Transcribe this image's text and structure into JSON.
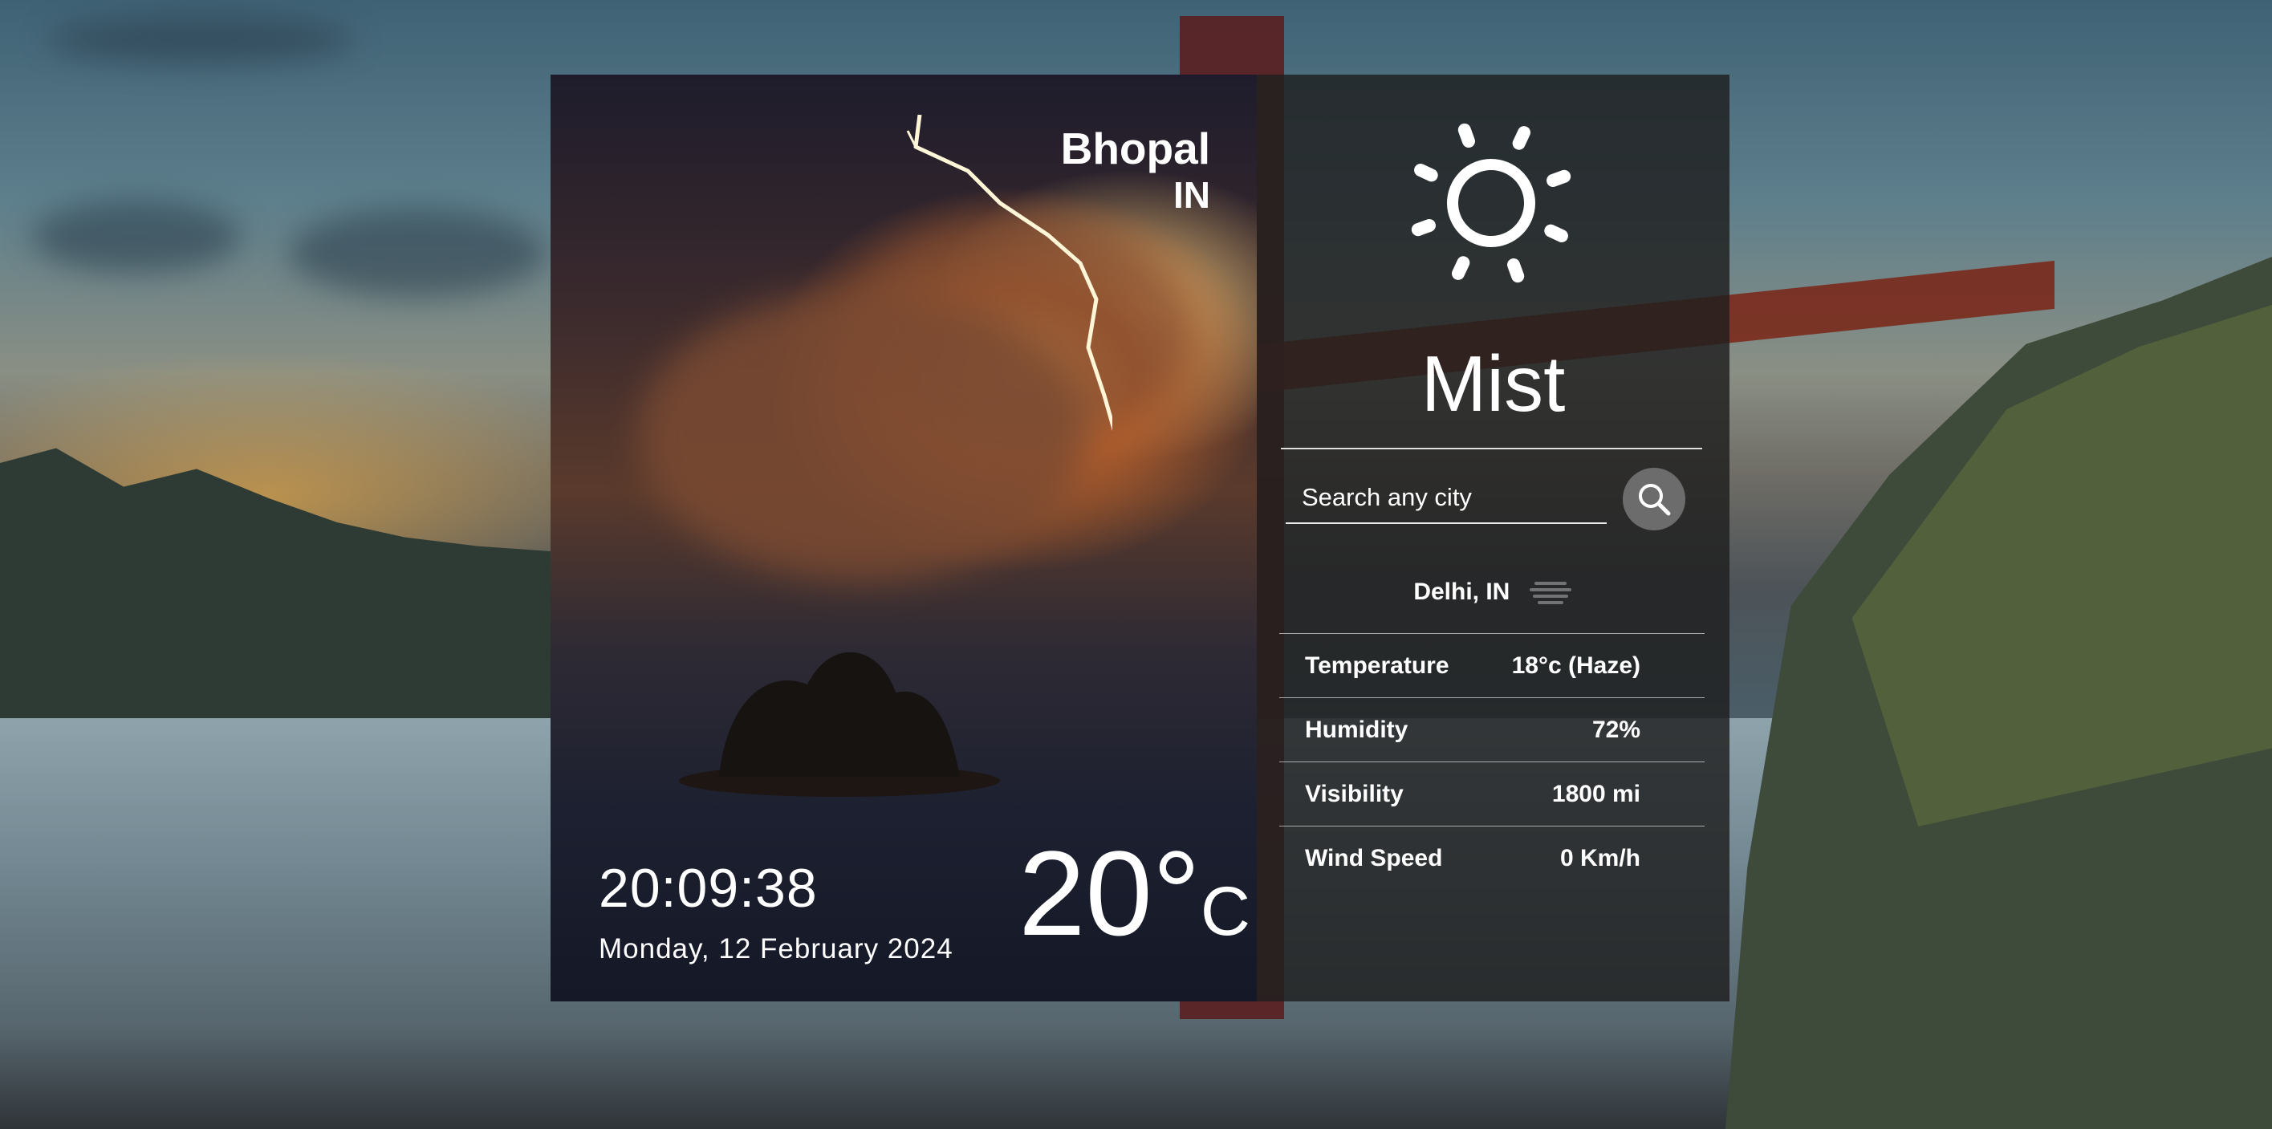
{
  "location": {
    "city": "Bhopal",
    "country": "IN"
  },
  "clock": {
    "time": "20:09:38",
    "date": "Monday, 12 February 2024"
  },
  "current": {
    "temperature": "20°",
    "unit": "C"
  },
  "condition": {
    "icon": "sun-icon",
    "label": "Mist"
  },
  "search": {
    "placeholder": "Search any city",
    "button_icon": "search-icon"
  },
  "result": {
    "location_label": "Delhi, IN",
    "icon": "haze-icon",
    "rows": [
      {
        "label": "Temperature",
        "value": "18°c (Haze)"
      },
      {
        "label": "Humidity",
        "value": "72%"
      },
      {
        "label": "Visibility",
        "value": "1800 mi"
      },
      {
        "label": "Wind Speed",
        "value": "0 Km/h"
      }
    ]
  }
}
